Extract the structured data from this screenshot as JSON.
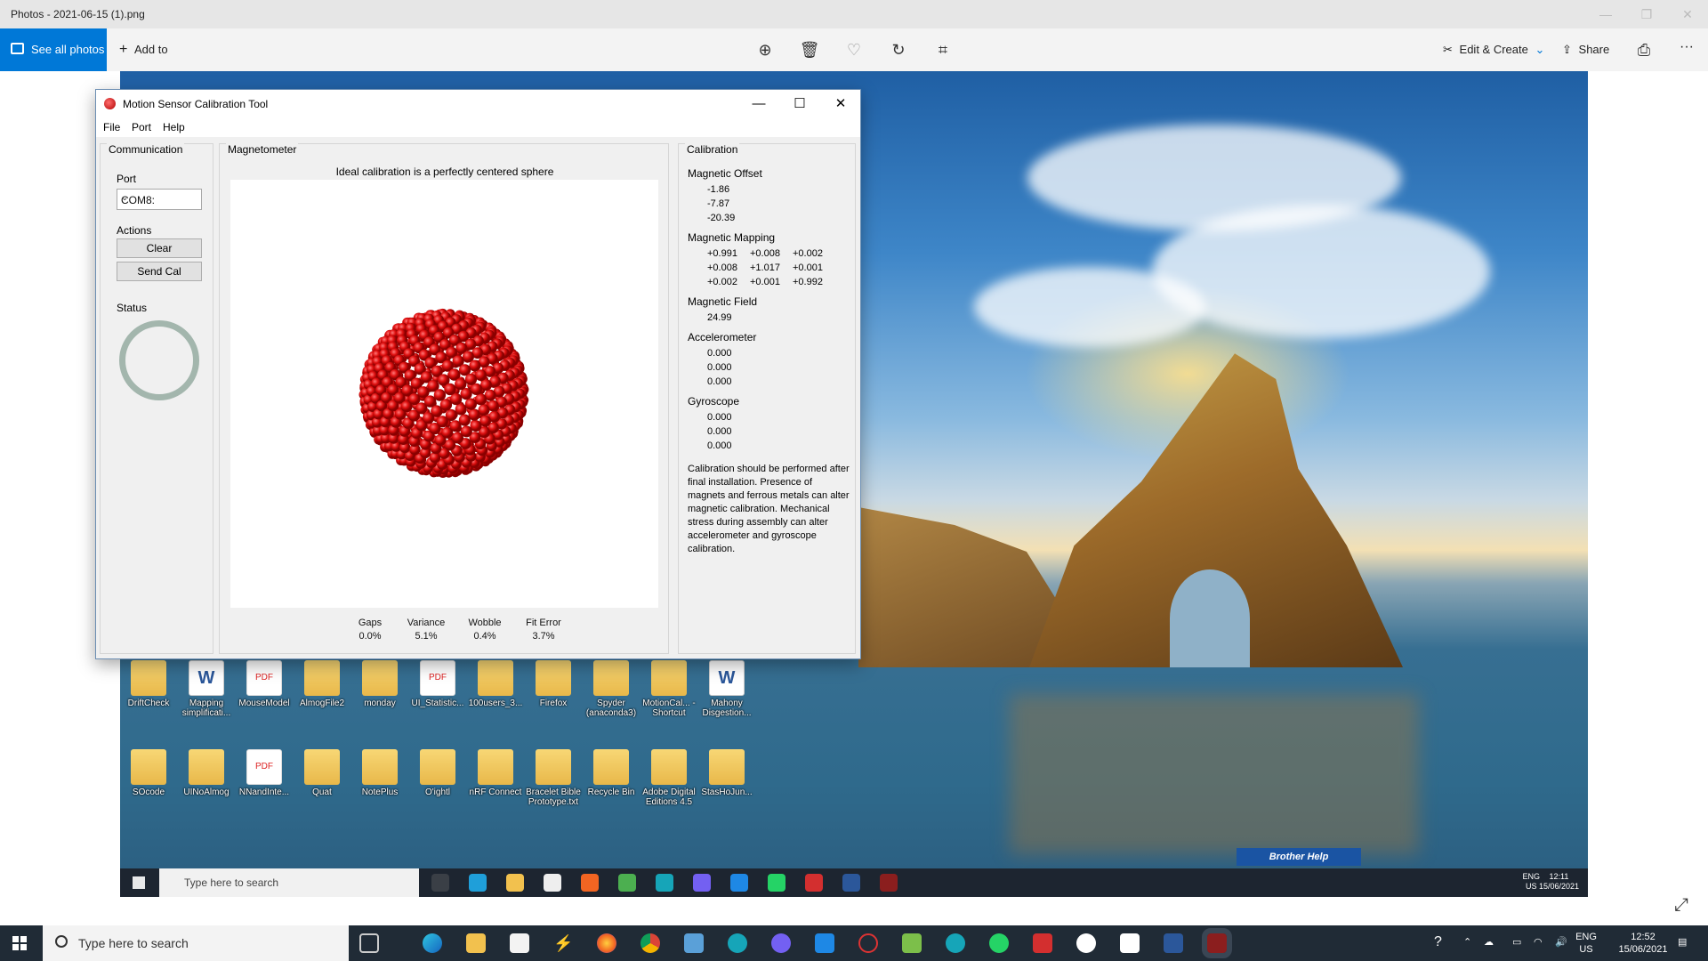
{
  "photos_app": {
    "window_title": "Photos - 2021-06-15 (1).png",
    "see_all_photos": "See all photos",
    "add_to": "Add to",
    "edit_create": "Edit & Create",
    "share": "Share",
    "more": "···",
    "icons": [
      "zoom-icon",
      "delete-icon",
      "favorite-icon",
      "rotate-icon",
      "crop-icon",
      "edit-icon",
      "share-icon",
      "print-icon"
    ]
  },
  "app": {
    "title": "Motion Sensor Calibration Tool",
    "menu": [
      "File",
      "Port",
      "Help"
    ],
    "communication": {
      "title": "Communication",
      "port_label": "Port",
      "port_value": "COM8:",
      "actions_label": "Actions",
      "clear": "Clear",
      "send_cal": "Send Cal",
      "status_label": "Status"
    },
    "magnetometer": {
      "title": "Magnetometer",
      "caption": "Ideal calibration is a perfectly centered sphere",
      "metrics": [
        {
          "label": "Gaps",
          "value": "0.0%"
        },
        {
          "label": "Variance",
          "value": "5.1%"
        },
        {
          "label": "Wobble",
          "value": "0.4%"
        },
        {
          "label": "Fit Error",
          "value": "3.7%"
        }
      ]
    },
    "calibration": {
      "title": "Calibration",
      "magnetic_offset_label": "Magnetic Offset",
      "magnetic_offset": [
        "-1.86",
        "-7.87",
        "-20.39"
      ],
      "magnetic_mapping_label": "Magnetic Mapping",
      "magnetic_mapping": [
        [
          "+0.991",
          "+0.008",
          "+0.002"
        ],
        [
          "+0.008",
          "+1.017",
          "+0.001"
        ],
        [
          "+0.002",
          "+0.001",
          "+0.992"
        ]
      ],
      "magnetic_field_label": "Magnetic Field",
      "magnetic_field": "24.99",
      "accelerometer_label": "Accelerometer",
      "accelerometer": [
        "0.000",
        "0.000",
        "0.000"
      ],
      "gyroscope_label": "Gyroscope",
      "gyroscope": [
        "0.000",
        "0.000",
        "0.000"
      ],
      "note": "Calibration should be performed after final installation.  Presence of magnets and ferrous metals can alter magnetic calibration. Mechanical stress during assembly can alter accelerometer and gyroscope calibration."
    }
  },
  "inner_desktop": {
    "row1": [
      "DriftCheck",
      "Mapping simplificati...",
      "MouseModel",
      "AlmogFile2",
      "monday",
      "UI_Statistic...",
      "100users_3...",
      "Firefox",
      "Spyder (anaconda3)",
      "MotionCal... - Shortcut",
      "Mahony Disgestion..."
    ],
    "row2": [
      "SOcode",
      "UINoAlmog",
      "NNandInte...",
      "Quat",
      "NotePlus",
      "O'ightl",
      "nRF Connect",
      "Bracelet Bible Prototype.txt",
      "Recycle Bin",
      "Adobe Digital Editions 4.5",
      "StasHoJun..."
    ],
    "taskbar_search": "Type here to search",
    "brother_help": "Brother Help",
    "tray_lang": "ENG",
    "tray_region": "US",
    "tray_time": "12:11",
    "tray_date": "15/06/2021"
  },
  "taskbar": {
    "search_placeholder": "Type here to search",
    "lang": "ENG",
    "region": "US",
    "time": "12:52",
    "date": "15/06/2021"
  },
  "colors": {
    "accent": "#0078d7",
    "sphere": "#e01010",
    "status_ring": "#a3b6ad"
  }
}
